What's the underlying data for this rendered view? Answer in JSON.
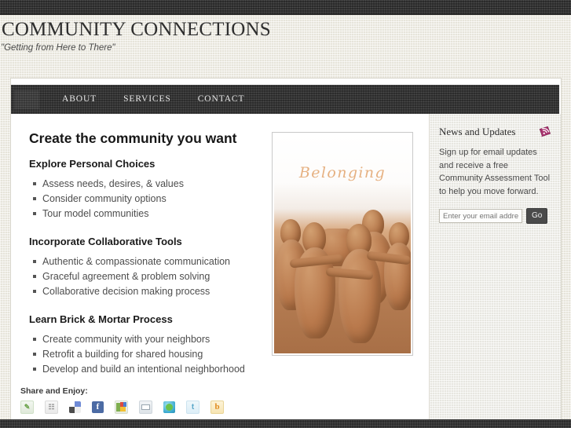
{
  "site": {
    "title": "COMMUNITY CONNECTIONS",
    "tagline": "\"Getting from Here to There\""
  },
  "nav": {
    "items": [
      {
        "label": "ABOUT"
      },
      {
        "label": "SERVICES"
      },
      {
        "label": "CONTACT"
      }
    ]
  },
  "main": {
    "heading": "Create the community you want",
    "sections": [
      {
        "subheading": "Explore Personal Choices",
        "items": [
          "Assess needs, desires, & values",
          "Consider community options",
          "Tour model communities"
        ]
      },
      {
        "subheading": "Incorporate Collaborative Tools",
        "items": [
          "Authentic & compassionate communication",
          "Graceful agreement & problem solving",
          "Collaborative decision making process"
        ]
      },
      {
        "subheading": "Learn Brick & Mortar Process",
        "items": [
          "Create community with your neighbors",
          "Retrofit a building for shared housing",
          "Develop and build an intentional neighborhood"
        ]
      }
    ],
    "figure": {
      "caption": "Belonging",
      "alt": "Terracotta clay figures embracing in a circle"
    }
  },
  "share": {
    "label": "Share and Enjoy:",
    "icons": [
      {
        "name": "print-friendly-icon",
        "glyph": "⎙"
      },
      {
        "name": "pdf-icon",
        "glyph": "✇"
      },
      {
        "name": "delicious-icon",
        "glyph": ""
      },
      {
        "name": "facebook-icon",
        "glyph": "f"
      },
      {
        "name": "google-bookmarks-icon",
        "glyph": ""
      },
      {
        "name": "email-icon",
        "glyph": ""
      },
      {
        "name": "stumbleupon-icon",
        "glyph": ""
      },
      {
        "name": "twitter-icon",
        "glyph": "t"
      },
      {
        "name": "blogger-icon",
        "glyph": "b"
      }
    ]
  },
  "sidebar": {
    "widget": {
      "title": "News and Updates",
      "rss_icon": "rss-feed-icon",
      "rss_color": "#a8336e",
      "text": "Sign up for email updates and receive a free Community Assessment Tool to help you move forward.",
      "email_placeholder": "Enter your email address...",
      "email_value": "",
      "submit_label": "Go"
    }
  },
  "colors": {
    "top_strip": "#3b3b3b",
    "nav_bar": "#3c3c3c",
    "page_bg": "#eceae0",
    "content_bg": "#ffffff",
    "sidebar_bg": "#efeee8",
    "accent_rss": "#a8336e"
  }
}
